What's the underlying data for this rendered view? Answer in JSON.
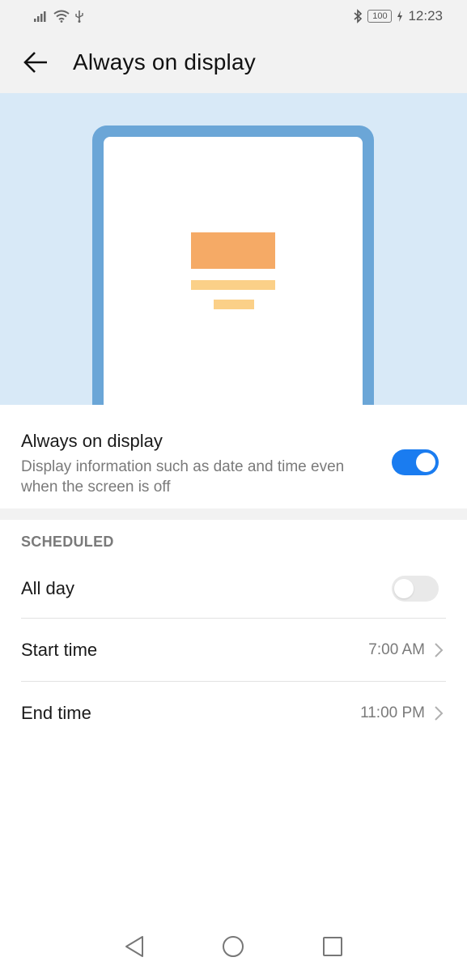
{
  "status_bar": {
    "time": "12:23",
    "battery": "100",
    "icons": [
      "signal-icon",
      "wifi-icon",
      "usb-icon",
      "bluetooth-icon",
      "battery-icon",
      "charging-icon"
    ]
  },
  "header": {
    "title": "Always on display",
    "back_icon": "back-arrow-icon"
  },
  "main_setting": {
    "title": "Always on display",
    "description": "Display information such as date and time even when the screen is off",
    "enabled": true
  },
  "scheduled": {
    "header": "SCHEDULED",
    "all_day": {
      "label": "All day",
      "enabled": false
    },
    "start_time": {
      "label": "Start time",
      "value": "7:00 AM"
    },
    "end_time": {
      "label": "End time",
      "value": "11:00 PM"
    }
  },
  "nav_bar": {
    "buttons": [
      "back-triangle-icon",
      "home-circle-icon",
      "recents-square-icon"
    ]
  },
  "colors": {
    "accent": "#1a7cf0",
    "hero_background": "#d8e9f7",
    "phone_frame": "#6ba6d7",
    "clock_block": "#f5aa66",
    "info_lines": "#fbd088"
  }
}
